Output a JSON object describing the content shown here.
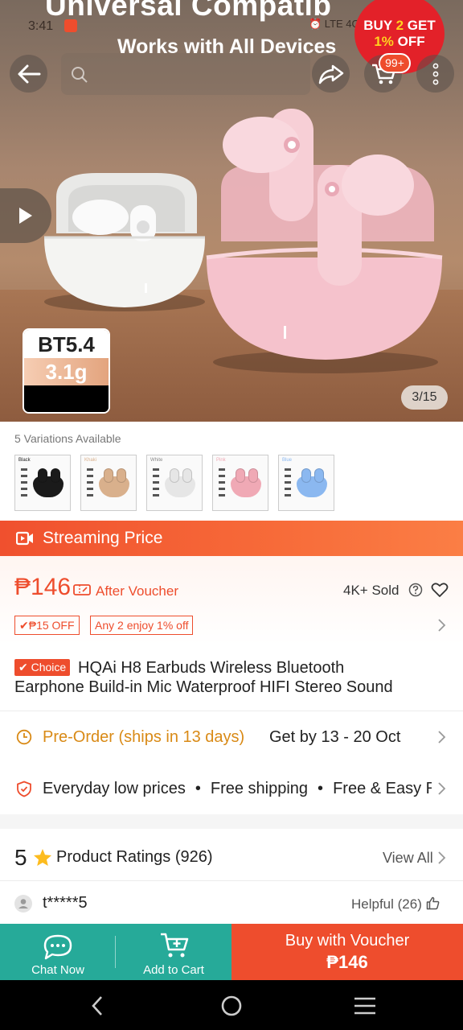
{
  "status_bar": {
    "time": "3:41",
    "right_text": "⏰ LTE 4G ▲ ▮▮ 74%"
  },
  "hero": {
    "banner_line1": "Universal Compatib",
    "banner_line2": "Works with All Devices",
    "promo_line1": {
      "a": "BUY ",
      "b": "2",
      "c": " GET"
    },
    "promo_line2": {
      "a": "1%",
      "b": " OFF"
    },
    "cart_badge": "99+",
    "bt_version": "BT5.4",
    "bt_weight": "3.1g",
    "pager": "3/15"
  },
  "variations": {
    "label": "5 Variations Available",
    "items": [
      {
        "name": "Black",
        "color": "#1a1a1a"
      },
      {
        "name": "Khaki",
        "color": "#d9b08c"
      },
      {
        "name": "White",
        "color": "#e6e6e6"
      },
      {
        "name": "Pink",
        "color": "#f0a9b5"
      },
      {
        "name": "Blue",
        "color": "#8bb8f0"
      }
    ]
  },
  "streaming": {
    "label": "Streaming Price"
  },
  "price": {
    "amount": "₱146",
    "after_voucher": "After Voucher",
    "sold": "4K+ Sold",
    "chips": [
      "✔₱15 OFF",
      "Any 2 enjoy 1% off"
    ]
  },
  "product": {
    "badge": "✔ Choice",
    "title_line1": "HQAi H8 Earbuds Wireless Bluetooth",
    "title_line2": "Earphone Build-in Mic Waterproof HIFI Stereo Sound"
  },
  "preorder": {
    "orange": "Pre-Order (ships in 13 days)",
    "date": "Get by 13 - 20 Oct"
  },
  "benefits": {
    "items": [
      "Everyday low prices",
      "Free shipping",
      "Free & Easy Returns"
    ]
  },
  "ratings": {
    "score": "5",
    "label": "Product Ratings (926)",
    "view_all": "View All"
  },
  "review": {
    "user": "t*****5",
    "helpful": "Helpful (26)"
  },
  "actions": {
    "chat": "Chat Now",
    "add_to_cart": "Add to Cart",
    "buy_line1": "Buy with Voucher",
    "buy_line2": "₱146"
  },
  "colors": {
    "brand": "#ee4d2d",
    "teal": "#26aa99",
    "preorder": "#d98a16"
  }
}
